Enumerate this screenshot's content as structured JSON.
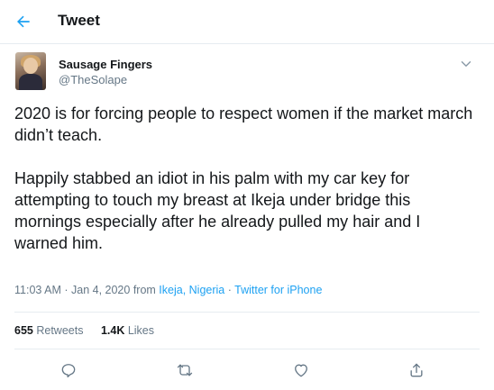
{
  "header": {
    "title": "Tweet",
    "back_icon": "arrow-left-icon"
  },
  "author": {
    "name": "Sausage Fingers",
    "handle": "@TheSolape"
  },
  "tweet": {
    "paragraph1": "2020 is for forcing people to respect women if the market march didn’t teach.",
    "paragraph2": "Happily stabbed an idiot in his palm with my car key for attempting to touch my breast at Ikeja under bridge this mornings especially after he already pulled my hair and I warned him."
  },
  "meta": {
    "time": "11:03 AM",
    "sep1": " · ",
    "date": "Jan 4, 2020",
    "from": " from ",
    "location": "Ikeja, Nigeria",
    "sep2": " · ",
    "source": "Twitter for iPhone"
  },
  "stats": {
    "retweets_count": "655",
    "retweets_label": "Retweets",
    "likes_count": "1.4K",
    "likes_label": "Likes"
  },
  "actions": [
    "reply-icon",
    "retweet-icon",
    "like-icon",
    "share-icon"
  ],
  "colors": {
    "accent": "#1da1f2",
    "muted": "#657786",
    "divider": "#e6ecf0"
  }
}
